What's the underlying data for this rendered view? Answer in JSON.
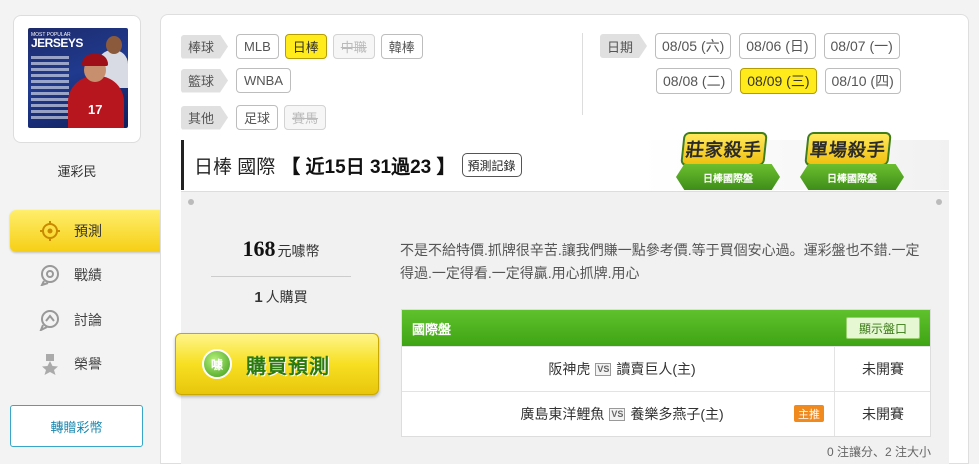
{
  "user": {
    "name": "運彩民",
    "avatar_text": "JERSEYS",
    "avatar_subtext": "MOST POPULAR"
  },
  "menu": [
    {
      "label": "預測",
      "icon": "target-icon",
      "active": true
    },
    {
      "label": "戰績",
      "icon": "record-icon",
      "active": false
    },
    {
      "label": "討論",
      "icon": "chat-icon",
      "active": false
    },
    {
      "label": "榮譽",
      "icon": "medal-icon",
      "active": false
    }
  ],
  "transfer_button": "轉贈彩幣",
  "filters": {
    "baseball": {
      "label": "棒球",
      "options": [
        "MLB",
        "日棒",
        "中職",
        "韓棒"
      ],
      "selected": "日棒",
      "disabled": [
        "中職"
      ]
    },
    "basketball": {
      "label": "籃球",
      "options": [
        "WNBA"
      ]
    },
    "other": {
      "label": "其他",
      "options": [
        "足球",
        "賽馬"
      ],
      "disabled": [
        "賽馬"
      ]
    },
    "date": {
      "label": "日期",
      "options": [
        "08/05 (六)",
        "08/06 (日)",
        "08/07 (一)",
        "08/08 (二)",
        "08/09 (三)",
        "08/10 (四)"
      ],
      "selected": "08/09 (三)"
    }
  },
  "header": {
    "title": "日棒 國際",
    "stat": "【 近15日 31過23 】",
    "record_button": "預測記錄",
    "badges": [
      {
        "top": "莊家殺手",
        "bottom": "日棒國際盤"
      },
      {
        "top": "單場殺手",
        "bottom": "日棒國際盤"
      }
    ]
  },
  "purchase": {
    "price": "168",
    "unit": "元噱幣",
    "buyers": "1",
    "buyers_suffix": "人購買",
    "buy_button": "購買預測",
    "buy_icon": "噱"
  },
  "description": "不是不給特價.抓牌很辛苦.讓我們賺一點參考價.等于買個安心過。運彩盤也不錯.一定得過.一定得看.一定得贏.用心抓牌.用心",
  "table": {
    "title": "國際盤",
    "toggle_label": "顯示盤口",
    "vs_label": "VS",
    "rows": [
      {
        "away": "阪神虎",
        "home": "讀賣巨人(主)",
        "tag": "",
        "status": "未開賽"
      },
      {
        "away": "廣島東洋鯉魚",
        "home": "養樂多燕子(主)",
        "tag": "主推",
        "status": "未開賽"
      }
    ]
  },
  "note": "0 注讓分、2 注大小",
  "colors": {
    "accent_yellow": "#ffeb1b",
    "green": "#3fa414",
    "blue_border": "#37a6c9",
    "orange_tag": "#f08a1f"
  }
}
